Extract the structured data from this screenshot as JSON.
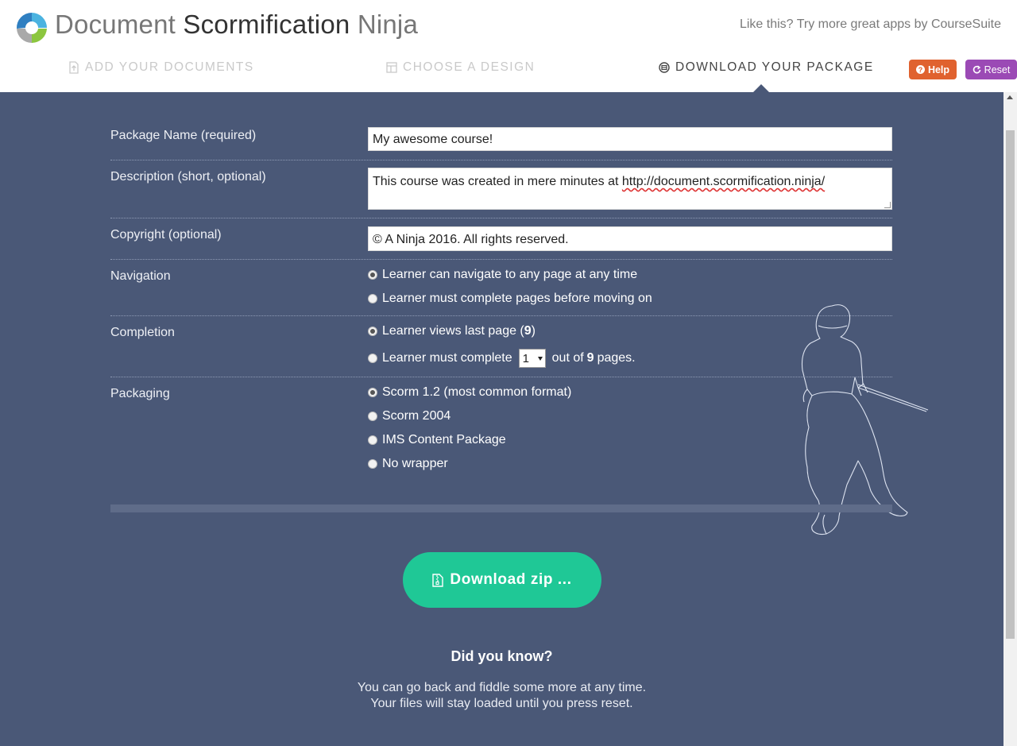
{
  "header": {
    "title_part1": "Document",
    "title_part2": "Scormification",
    "title_part3": "Ninja",
    "promo": "Like this? Try more great apps by CourseSuite",
    "help_label": "Help",
    "reset_label": "Reset"
  },
  "steps": [
    {
      "label": "ADD YOUR DOCUMENTS",
      "icon": "upload-file-icon",
      "active": false
    },
    {
      "label": "CHOOSE A DESIGN",
      "icon": "layout-grid-icon",
      "active": false
    },
    {
      "label": "DOWNLOAD YOUR PACKAGE",
      "icon": "package-icon",
      "active": true
    }
  ],
  "form": {
    "package_name": {
      "label": "Package Name (required)",
      "value": "My awesome course!"
    },
    "description": {
      "label": "Description (short, optional)",
      "value_prefix": "This course was created in mere minutes at ",
      "value_url": "http://document.scormification.ninja/"
    },
    "copyright": {
      "label": "Copyright (optional)",
      "value": "© A Ninja 2016. All rights reserved."
    },
    "navigation": {
      "label": "Navigation",
      "options": [
        "Learner can navigate to any page at any time",
        "Learner must complete pages before moving on"
      ],
      "selected": 0
    },
    "completion": {
      "label": "Completion",
      "option1_text": "Learner views last page (",
      "option1_count": "9",
      "option1_close": ")",
      "option2_before": "Learner must complete",
      "option2_select": "1",
      "option2_middle": "out of",
      "option2_count": "9",
      "option2_after": "pages.",
      "selected": 0
    },
    "packaging": {
      "label": "Packaging",
      "options": [
        "Scorm 1.2 (most common format)",
        "Scorm 2004",
        "IMS Content Package",
        "No wrapper"
      ],
      "selected": 0
    }
  },
  "download": {
    "label": "Download zip ..."
  },
  "tip": {
    "title": "Did you know?",
    "line1": "You can go back and fiddle some more at any time.",
    "line2": "Your files will stay loaded until you press reset."
  },
  "colors": {
    "background": "#4a5877",
    "download_button": "#1fc896",
    "help_button": "#e0622f",
    "reset_button": "#9b4ab5"
  }
}
